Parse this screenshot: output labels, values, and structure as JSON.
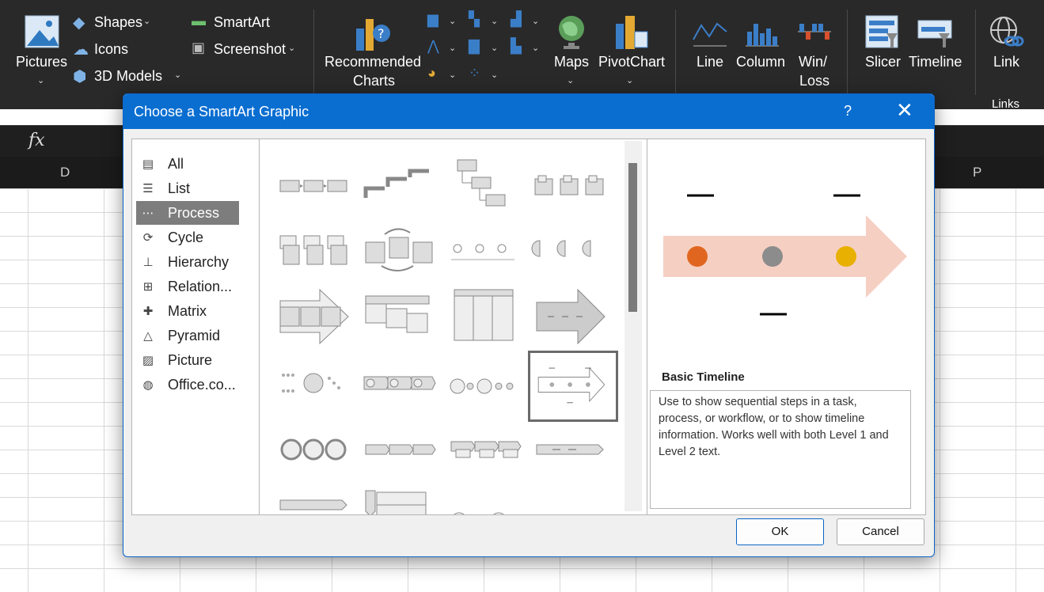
{
  "ribbon": {
    "pictures": "Pictures",
    "shapes": "Shapes",
    "icons": "Icons",
    "models3d": "3D Models",
    "smartart": "SmartArt",
    "screenshot": "Screenshot",
    "recommended_line1": "Recommended",
    "recommended_line2": "Charts",
    "maps": "Maps",
    "pivotchart": "PivotChart",
    "line": "Line",
    "column": "Column",
    "winloss_line1": "Win/",
    "winloss_line2": "Loss",
    "slicer": "Slicer",
    "timeline": "Timeline",
    "link": "Link",
    "links_group": "Links"
  },
  "formula_bar": {
    "fx": "fx"
  },
  "columns": {
    "d": "D",
    "p": "P"
  },
  "dialog": {
    "title": "Choose a SmartArt Graphic",
    "help": "?",
    "close": "✕",
    "categories": [
      {
        "label": "All",
        "icon": "all-icon"
      },
      {
        "label": "List",
        "icon": "list-icon"
      },
      {
        "label": "Process",
        "icon": "process-icon"
      },
      {
        "label": "Cycle",
        "icon": "cycle-icon"
      },
      {
        "label": "Hierarchy",
        "icon": "hierarchy-icon"
      },
      {
        "label": "Relation...",
        "icon": "relationship-icon"
      },
      {
        "label": "Matrix",
        "icon": "matrix-icon"
      },
      {
        "label": "Pyramid",
        "icon": "pyramid-icon"
      },
      {
        "label": "Picture",
        "icon": "picture-icon"
      },
      {
        "label": "Office.co...",
        "icon": "globe-icon"
      }
    ],
    "selected_category": "Process",
    "preview": {
      "name": "Basic Timeline",
      "description": "Use to show sequential steps in a task, process, or workflow, or to show timeline information. Works well with both Level 1 and Level 2 text.",
      "dot_colors": [
        "#e0661f",
        "#8c8c8c",
        "#e8b000"
      ],
      "arrow_color": "#f6cfc3"
    },
    "ok": "OK",
    "cancel": "Cancel"
  }
}
